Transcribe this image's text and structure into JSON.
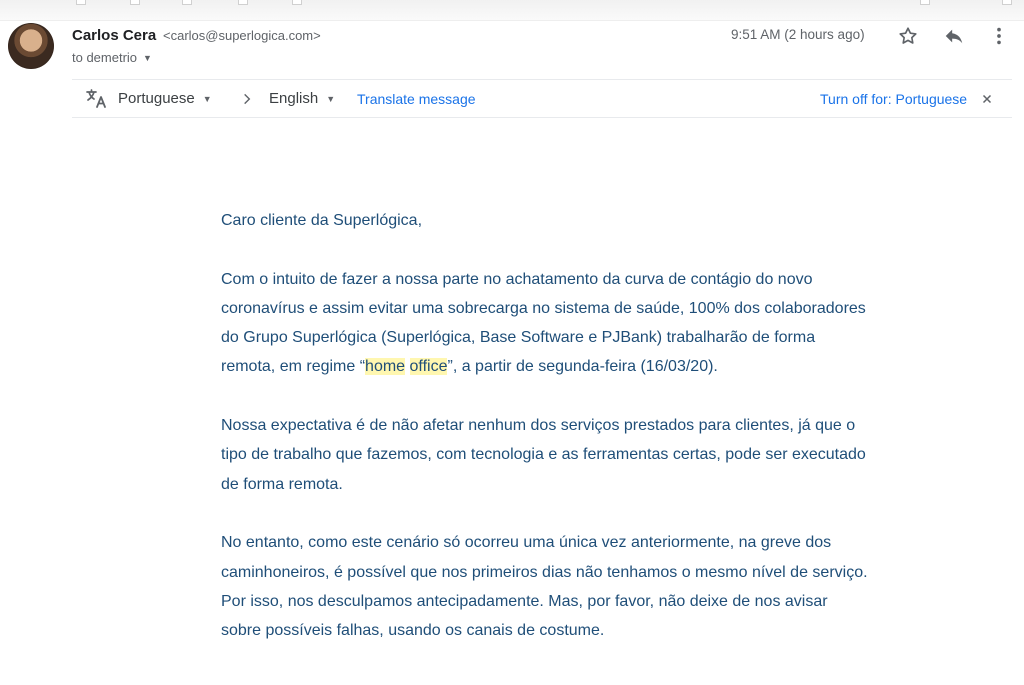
{
  "header": {
    "sender_name": "Carlos Cera",
    "sender_email": "<carlos@superlogica.com>",
    "to_line": "to demetrio",
    "timestamp": "9:51 AM (2 hours ago)",
    "icons": {
      "star": "star-icon",
      "reply": "reply-icon",
      "more": "more-vert-icon",
      "expand": "chevron-down-icon"
    }
  },
  "translate_bar": {
    "source_language": "Portuguese",
    "target_language": "English",
    "translate_link": "Translate message",
    "turn_off_link": "Turn off for: Portuguese",
    "icons": {
      "translate": "translate-icon",
      "arrow": "chevron-right-icon",
      "close": "close-icon"
    }
  },
  "message": {
    "greeting": "Caro cliente da Superlógica,",
    "p1_before": "Com o intuito de fazer a nossa parte no achatamento da curva de contágio do novo coronavírus e assim evitar uma sobrecarga no sistema de saúde, 100% dos colaboradores do Grupo Superlógica (Superlógica, Base Software e PJBank) trabalharão de forma remota, em regime “",
    "p1_highlight_1": "home",
    "p1_space": " ",
    "p1_highlight_2": "office",
    "p1_after": "”, a partir de segunda-feira (16/03/20).",
    "p2": "Nossa expectativa é de não afetar nenhum dos serviços prestados para clientes, já que o tipo de trabalho que fazemos, com tecnologia e as ferramentas certas, pode ser executado de forma remota.",
    "p3": "No entanto, como este cenário só ocorreu uma única vez anteriormente, na greve dos caminhoneiros, é possível que nos primeiros dias não tenhamos o mesmo nível de serviço. Por isso, nos desculpamos antecipadamente. Mas, por favor, não deixe de nos avisar sobre possíveis falhas, usando os canais de costume."
  },
  "colors": {
    "body_text": "#1f4e78",
    "link": "#1a73e8",
    "highlight": "#fff7b0",
    "meta_text": "#5f6368"
  }
}
